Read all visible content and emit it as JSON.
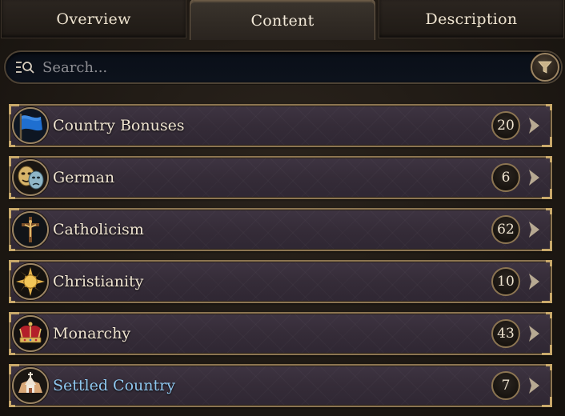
{
  "tabs": [
    {
      "label": "Overview",
      "active": false
    },
    {
      "label": "Content",
      "active": true
    },
    {
      "label": "Description",
      "active": false
    }
  ],
  "search": {
    "placeholder": "Search...",
    "value": ""
  },
  "filter_icon": "funnel-icon",
  "colors": {
    "accent_gold": "#c9a96a",
    "highlight_blue": "#8fc7ef",
    "text": "#efe4d0"
  },
  "items": [
    {
      "label": "Country Bonuses",
      "count": "20",
      "icon": "blue-flag-icon"
    },
    {
      "label": "German",
      "count": "6",
      "icon": "theatre-masks-icon"
    },
    {
      "label": "Catholicism",
      "count": "62",
      "icon": "crucifix-icon"
    },
    {
      "label": "Christianity",
      "count": "10",
      "icon": "sun-icon"
    },
    {
      "label": "Monarchy",
      "count": "43",
      "icon": "crown-icon"
    },
    {
      "label": "Settled Country",
      "count": "7",
      "icon": "settlement-icon",
      "highlight": true
    }
  ]
}
